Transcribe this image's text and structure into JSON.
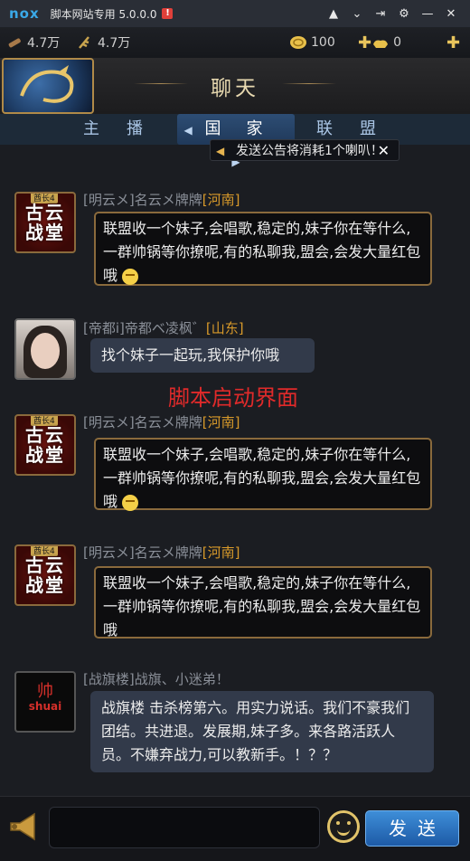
{
  "window": {
    "logo": "nox",
    "title": "脚本网站专用 5.0.0.0",
    "badge": "!",
    "controls": [
      "shirt-icon",
      "chevron-down-icon",
      "pin-icon",
      "gear-icon",
      "minimize-icon",
      "close-icon"
    ]
  },
  "resources": {
    "wood": "4.7万",
    "food": "4.7万",
    "gold": "100",
    "ingot": "0"
  },
  "header": {
    "title": "聊天"
  },
  "tabs": [
    {
      "label": "主播",
      "active": false
    },
    {
      "label": "国家",
      "active": true
    },
    {
      "label": "联盟",
      "active": false
    }
  ],
  "notice": {
    "text": "发送公告将消耗1个喇叭！"
  },
  "messages": [
    {
      "avatar": "club",
      "avatar_text": "古云战堂",
      "avatar_tag": "酋长4",
      "name": "[明云メ]名云メ牌牌",
      "province": "[河南]",
      "text": "联盟收一个妹子,会唱歌,稳定的,妹子你在等什么,一群帅锅等你撩呢,有的私聊我,盟会,会发大量红包哦",
      "emoji": true,
      "style": "dark"
    },
    {
      "avatar": "photo",
      "name": "[帝都i]帝都ベ凌枫゛",
      "province": "[山东]",
      "text": "找个妹子一起玩,我保护你哦",
      "emoji": false,
      "style": "blue"
    },
    {
      "avatar": "club",
      "avatar_text": "古云战堂",
      "avatar_tag": "酋长4",
      "name": "[明云メ]名云メ牌牌",
      "province": "[河南]",
      "text": "联盟收一个妹子,会唱歌,稳定的,妹子你在等什么,一群帅锅等你撩呢,有的私聊我,盟会,会发大量红包哦",
      "emoji": true,
      "style": "dark"
    },
    {
      "avatar": "club",
      "avatar_text": "古云战堂",
      "avatar_tag": "酋长4",
      "name": "[明云メ]名云メ牌牌",
      "province": "[河南]",
      "text": "联盟收一个妹子,会唱歌,稳定的,妹子你在等什么,一群帅锅等你撩呢,有的私聊我,盟会,会发大量红包哦",
      "emoji": false,
      "style": "dark"
    },
    {
      "avatar": "shuai",
      "avatar_text_cn": "帅",
      "avatar_text_en": "shuai",
      "name": "[战旗楼]战旗、小迷弟！",
      "province": "",
      "text": "战旗楼 击杀榜第六。用实力说话。我们不豪我们团结。共进退。发展期,妹子多。来各路活跃人员。不嫌弃战力,可以教新手。！？？",
      "emoji": false,
      "style": "blue"
    }
  ],
  "watermark": "脚本启动界面",
  "input": {
    "value": "",
    "send_label": "发送"
  }
}
